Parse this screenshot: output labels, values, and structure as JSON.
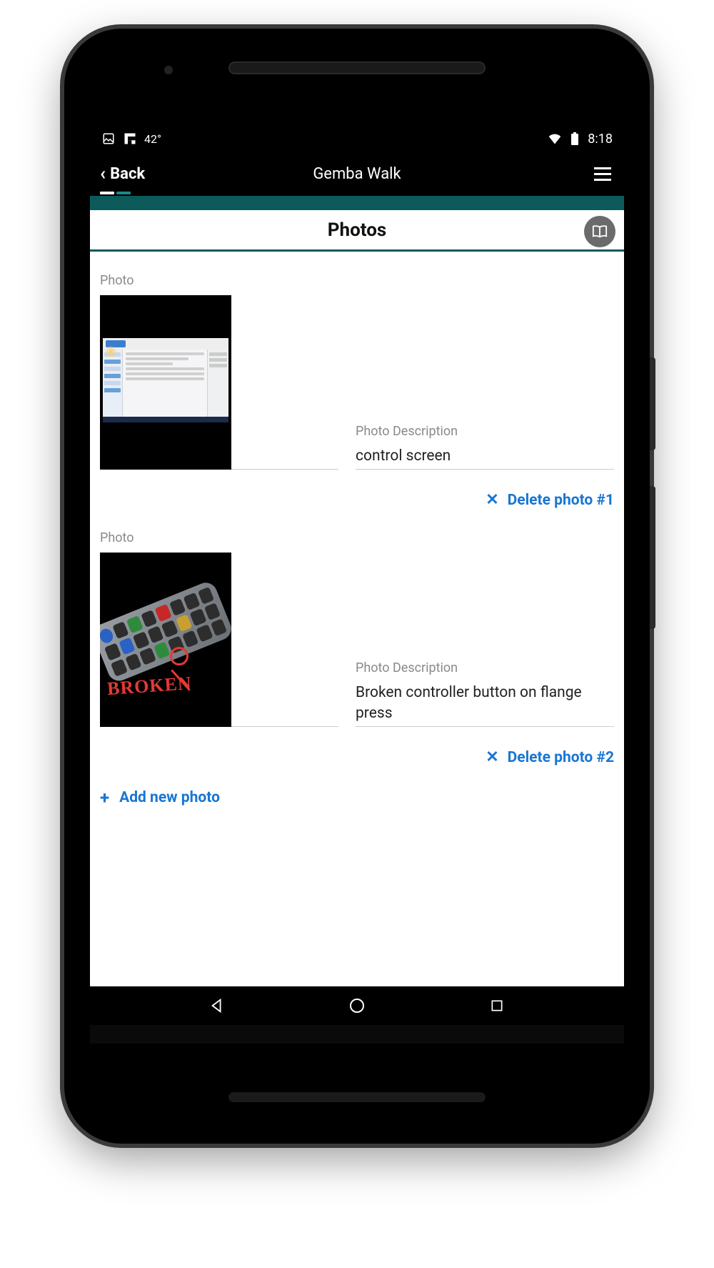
{
  "status": {
    "temperature": "42°",
    "time": "8:18"
  },
  "header": {
    "back_label": "Back",
    "title": "Gemba Walk"
  },
  "section": {
    "title": "Photos"
  },
  "labels": {
    "photo": "Photo",
    "photo_description": "Photo Description",
    "delete_prefix": "Delete photo #",
    "add_new_photo": "Add new photo"
  },
  "photos": [
    {
      "description": "control screen",
      "delete_label": "Delete photo #1",
      "annotation": ""
    },
    {
      "description": "Broken controller button on flange press",
      "delete_label": "Delete photo #2",
      "annotation": "BROKEN"
    }
  ],
  "colors": {
    "link": "#1976d2",
    "teal": "#0d5a5a",
    "annotation_red": "#e53935"
  }
}
